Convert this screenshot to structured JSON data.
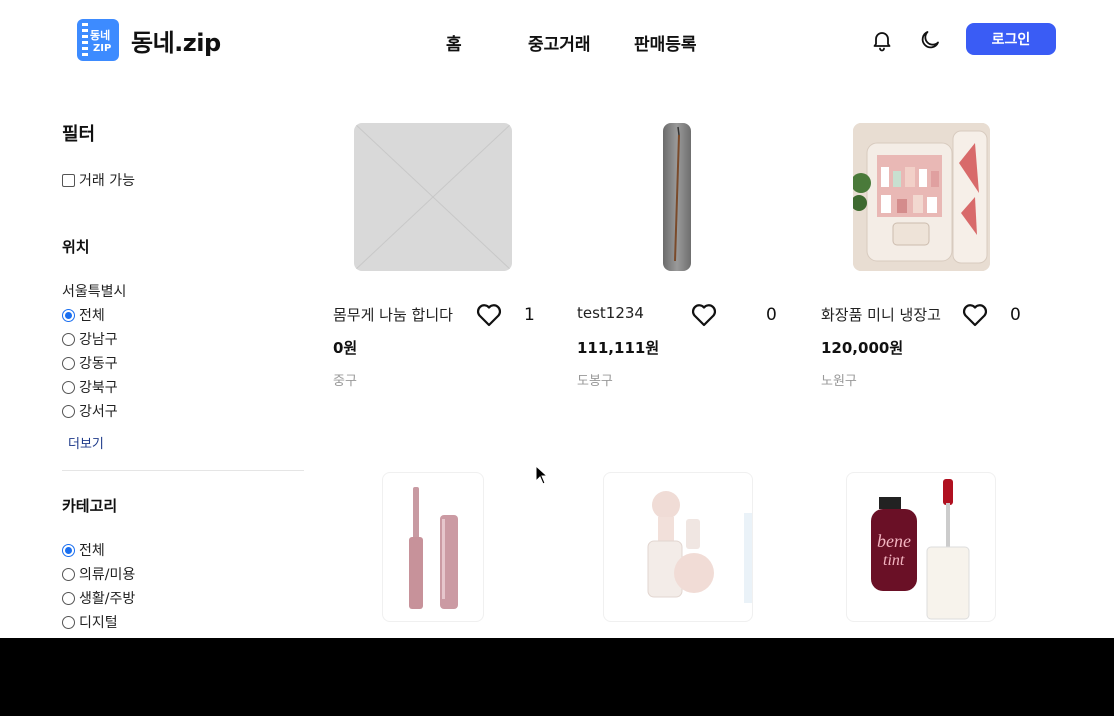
{
  "header": {
    "logo_text": "동네.zip",
    "logo_icon_top": "동네",
    "logo_icon_bottom": "ZIP",
    "nav": [
      "홈",
      "중고거래",
      "판매등록"
    ],
    "login_label": "로그인"
  },
  "sidebar": {
    "title": "필터",
    "available_label": "거래 가능",
    "location_title": "위치",
    "city": "서울특별시",
    "districts": [
      "전체",
      "강남구",
      "강동구",
      "강북구",
      "강서구"
    ],
    "more_label": "더보기",
    "category_title": "카테고리",
    "categories": [
      "전체",
      "의류/미용",
      "생활/주방",
      "디지털"
    ]
  },
  "products": [
    {
      "name": "몸무게 나눔 합니다",
      "likes": "1",
      "price": "0원",
      "location": "중구"
    },
    {
      "name": "test1234",
      "likes": "0",
      "price": "111,111원",
      "location": "도봉구"
    },
    {
      "name": "화장품 미니 냉장고",
      "likes": "0",
      "price": "120,000원",
      "location": "노원구"
    }
  ],
  "colors": {
    "primary": "#3a5cf5",
    "logo": "#3d8bff",
    "radio": "#1a6ff0"
  }
}
